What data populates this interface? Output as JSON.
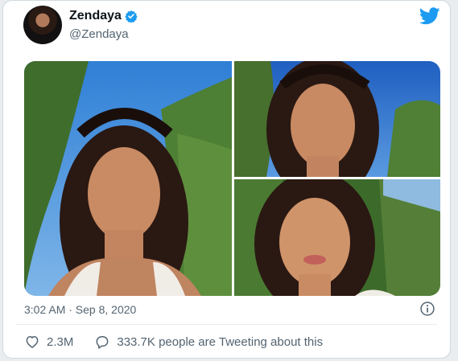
{
  "tweet": {
    "author_name": "Zendaya",
    "author_handle": "@Zendaya",
    "timestamp": "3:02 AM · Sep 8, 2020",
    "likes": "2.3M",
    "discussion": "333.7K people are Tweeting about this",
    "icons": {
      "verified": "verified-badge-icon",
      "logo": "twitter-bird-icon",
      "info": "info-icon",
      "like": "heart-icon",
      "reply": "speech-bubble-icon"
    },
    "colors": {
      "brand_blue": "#1d9bf0",
      "muted_text": "#536471",
      "border": "#cfd9de"
    },
    "media_count": 3
  }
}
